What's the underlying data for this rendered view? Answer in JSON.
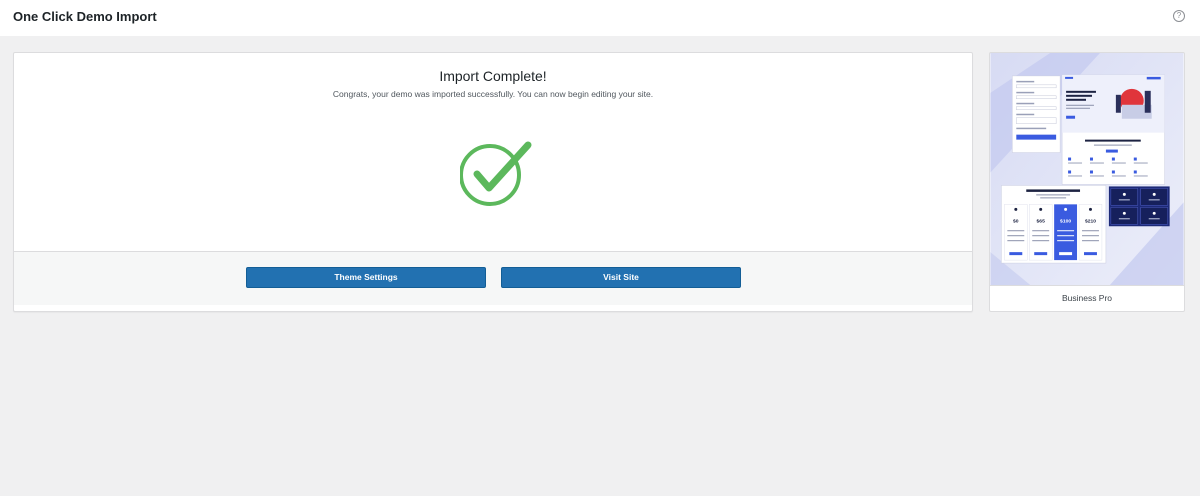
{
  "header": {
    "title": "One Click Demo Import",
    "help_icon_glyph": "?"
  },
  "main": {
    "heading": "Import Complete!",
    "subtitle": "Congrats, your demo was imported successfully. You can now begin editing your site.",
    "success_icon": "check-circle-icon",
    "success_color": "#5cb85c",
    "buttons": {
      "theme_settings": "Theme Settings",
      "visit_site": "Visit Site"
    }
  },
  "demo": {
    "name": "Business Pro",
    "preview": {
      "hero_text": "OCM Sites is a line of manageable templates.",
      "support_heading": "Our team will support you at all times",
      "pricing_heading": "Affordable Pricing Plans",
      "prices": [
        "$0",
        "$65",
        "$100",
        "$210"
      ]
    }
  },
  "colors": {
    "accent": "#2271b1",
    "page_bg": "#f0f0f1"
  }
}
